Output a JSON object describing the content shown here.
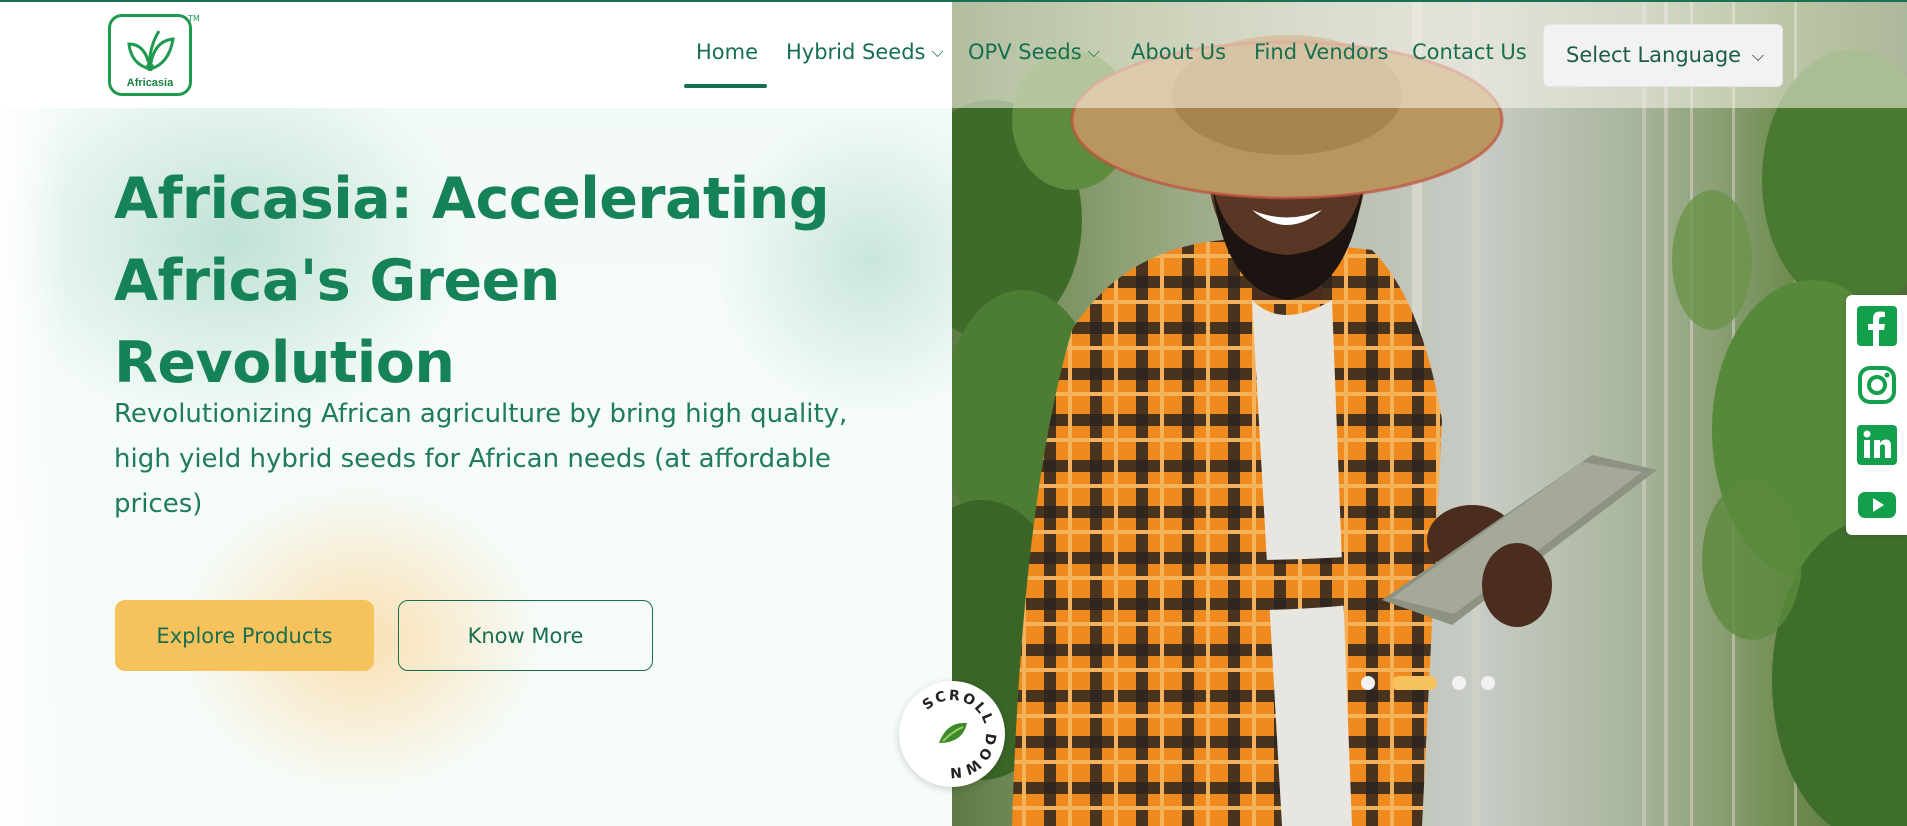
{
  "header": {
    "logo": {
      "text": "Africasia",
      "tm": "TM"
    },
    "nav": [
      {
        "label": "Home",
        "active": true,
        "dropdown": false
      },
      {
        "label": "Hybrid Seeds",
        "active": false,
        "dropdown": true
      },
      {
        "label": "OPV Seeds",
        "active": false,
        "dropdown": true
      },
      {
        "label": "About Us",
        "active": false,
        "dropdown": false
      },
      {
        "label": "Find Vendors",
        "active": false,
        "dropdown": false
      },
      {
        "label": "Contact Us",
        "active": false,
        "dropdown": false
      }
    ],
    "language_select": {
      "value": "Select Language",
      "icon": "chevron-down-icon"
    }
  },
  "hero": {
    "title_line1": "Africasia: Accelerating",
    "title_line2": "Africa's Green Revolution",
    "subtitle": "Revolutionizing African agriculture by bring high quality, high yield hybrid seeds for African needs (at affordable prices)",
    "primary_button": "Explore Products",
    "secondary_button": "Know More"
  },
  "scroll_badge": {
    "text": "SCROLL DOWN",
    "icon": "leaf-icon"
  },
  "carousel": {
    "slide_count": 4,
    "active_index": 1
  },
  "social": [
    {
      "name": "facebook",
      "icon": "facebook-icon"
    },
    {
      "name": "instagram",
      "icon": "instagram-icon"
    },
    {
      "name": "linkedin",
      "icon": "linkedin-icon"
    },
    {
      "name": "youtube",
      "icon": "youtube-icon"
    }
  ],
  "colors": {
    "brand_green": "#168257",
    "nav_green": "#16704f",
    "accent_yellow": "#f6c25c",
    "social_green": "#12a04c"
  }
}
